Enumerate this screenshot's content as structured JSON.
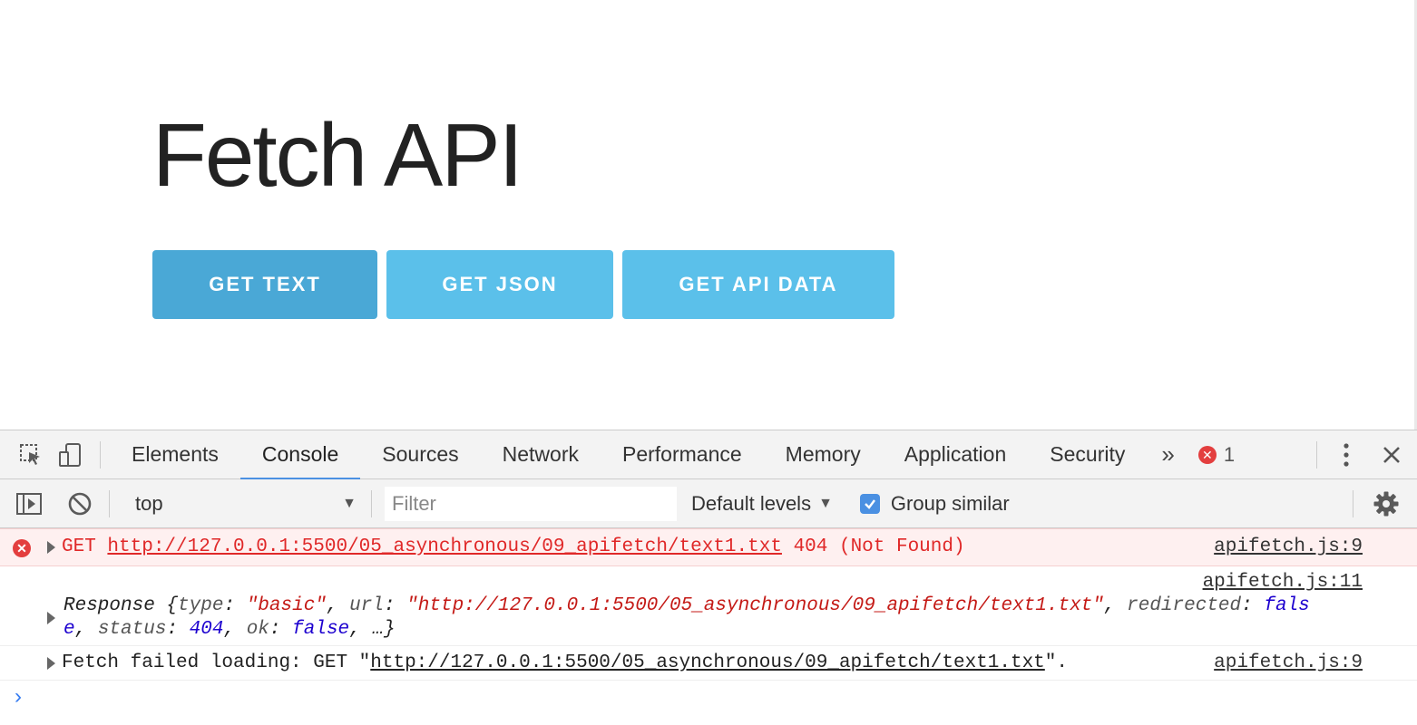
{
  "page": {
    "title": "Fetch API",
    "buttons": [
      {
        "label": "GET TEXT"
      },
      {
        "label": "GET JSON"
      },
      {
        "label": "GET API DATA"
      }
    ]
  },
  "devtools": {
    "tabs": [
      {
        "label": "Elements"
      },
      {
        "label": "Console"
      },
      {
        "label": "Sources"
      },
      {
        "label": "Network"
      },
      {
        "label": "Performance"
      },
      {
        "label": "Memory"
      },
      {
        "label": "Application"
      },
      {
        "label": "Security"
      }
    ],
    "more_tabs": "»",
    "error_count": "1",
    "error_dot": "✕",
    "toolbar": {
      "context": "top",
      "filter_placeholder": "Filter",
      "levels": "Default levels",
      "group_similar": "Group similar"
    },
    "messages": {
      "error": {
        "method": "GET",
        "url": "http://127.0.0.1:5500/05_asynchronous/09_apifetch/text1.txt",
        "status": "404 (Not Found)",
        "source": "apifetch.js:9"
      },
      "response": {
        "source": "apifetch.js:11",
        "name": "Response",
        "type_key": "type",
        "type_val": "\"basic\"",
        "url_key": "url",
        "url_val": "\"http://127.0.0.1:5500/05_asynchronous/09_apifetch/text1.txt\"",
        "redirected_key": "redirected",
        "redirected_val_a": "fals",
        "redirected_val_b": "e",
        "status_key": "status",
        "status_val": "404",
        "ok_key": "ok",
        "ok_val": "false",
        "ellipsis": "…}"
      },
      "fetch_failed": {
        "prefix": "Fetch failed loading: GET \"",
        "url": "http://127.0.0.1:5500/05_asynchronous/09_apifetch/text1.txt",
        "suffix": "\".",
        "source": "apifetch.js:9"
      }
    },
    "prompt": "›"
  },
  "colors": {
    "button": "#5bc0ea",
    "button_active": "#4aa8d6",
    "error_red": "#e02828",
    "tab_underline": "#4a90e2"
  }
}
